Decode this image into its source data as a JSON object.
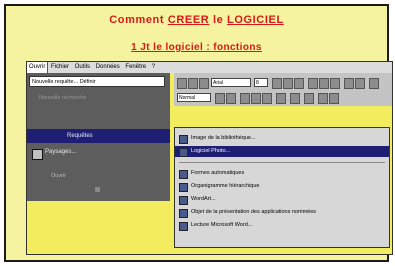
{
  "page": {
    "title_prefix": "Comment",
    "title_link1": "CREER",
    "title_mid": "le",
    "title_link2": "LOGICIEL",
    "subtitle": "1 Jt le logiciel : fonctions"
  },
  "menubar": {
    "items": [
      {
        "label": "Ouvrir"
      },
      {
        "label": "Fichier"
      },
      {
        "label": "Outils"
      },
      {
        "label": "Données"
      },
      {
        "label": "Fenêtre"
      },
      {
        "label": "?"
      }
    ]
  },
  "left_panel": {
    "dropdown": "Nouvelle requête...     Définir",
    "faded": "Nouvelle recherche",
    "selected": "Requêtes",
    "item_label": "Paysages...",
    "dim_label": "Ouvrir"
  },
  "toolbar": {
    "font_value": "Arial",
    "size_value": "8",
    "style_value": "Normal"
  },
  "menu": {
    "items": [
      {
        "label": "Image de la bibliothèque..."
      },
      {
        "label": "Logiciel Photo..."
      },
      {
        "label": "Formes automatiques"
      },
      {
        "label": "Organigramme hiérarchique"
      },
      {
        "label": "WordArt..."
      },
      {
        "label": "Objet de la présentation des applications nommées"
      },
      {
        "label": "Lecture Microsoft Word..."
      }
    ]
  },
  "colors": {
    "title_red": "#d81818",
    "page_yellow": "#f6f3a0",
    "highlight_navy": "#1e1e73"
  }
}
